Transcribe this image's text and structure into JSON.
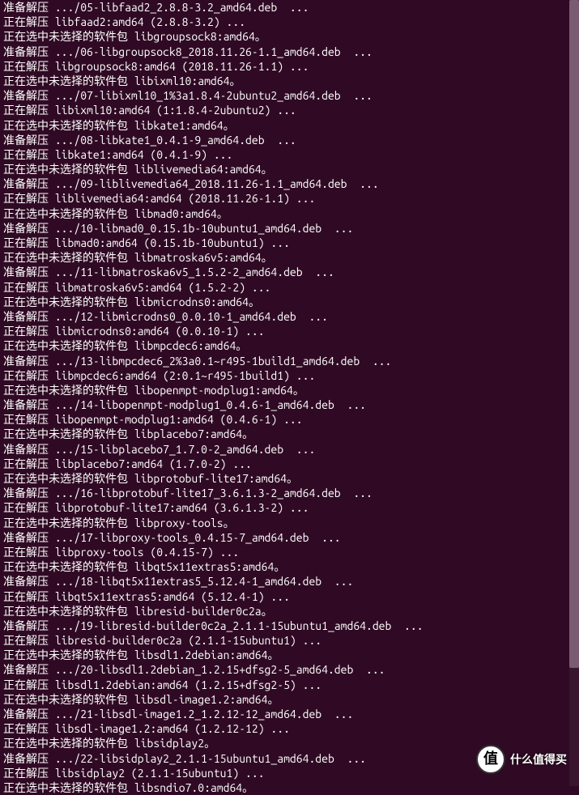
{
  "terminal": {
    "lines": [
      "准备解压 .../05-libfaad2_2.8.8-3.2_amd64.deb  ...",
      "正在解压 libfaad2:amd64 (2.8.8-3.2) ...",
      "正在选中未选择的软件包 libgroupsock8:amd64。",
      "准备解压 .../06-libgroupsock8_2018.11.26-1.1_amd64.deb  ...",
      "正在解压 libgroupsock8:amd64 (2018.11.26-1.1) ...",
      "正在选中未选择的软件包 libixml10:amd64。",
      "准备解压 .../07-libixml10_1%3a1.8.4-2ubuntu2_amd64.deb  ...",
      "正在解压 libixml10:amd64 (1:1.8.4-2ubuntu2) ...",
      "正在选中未选择的软件包 libkate1:amd64。",
      "准备解压 .../08-libkate1_0.4.1-9_amd64.deb  ...",
      "正在解压 libkate1:amd64 (0.4.1-9) ...",
      "正在选中未选择的软件包 liblivemedia64:amd64。",
      "准备解压 .../09-liblivemedia64_2018.11.26-1.1_amd64.deb  ...",
      "正在解压 liblivemedia64:amd64 (2018.11.26-1.1) ...",
      "正在选中未选择的软件包 libmad0:amd64。",
      "准备解压 .../10-libmad0_0.15.1b-10ubuntu1_amd64.deb  ...",
      "正在解压 libmad0:amd64 (0.15.1b-10ubuntu1) ...",
      "正在选中未选择的软件包 libmatroska6v5:amd64。",
      "准备解压 .../11-libmatroska6v5_1.5.2-2_amd64.deb  ...",
      "正在解压 libmatroska6v5:amd64 (1.5.2-2) ...",
      "正在选中未选择的软件包 libmicrodns0:amd64。",
      "准备解压 .../12-libmicrodns0_0.0.10-1_amd64.deb  ...",
      "正在解压 libmicrodns0:amd64 (0.0.10-1) ...",
      "正在选中未选择的软件包 libmpcdec6:amd64。",
      "准备解压 .../13-libmpcdec6_2%3a0.1~r495-1build1_amd64.deb  ...",
      "正在解压 libmpcdec6:amd64 (2:0.1~r495-1build1) ...",
      "正在选中未选择的软件包 libopenmpt-modplug1:amd64。",
      "准备解压 .../14-libopenmpt-modplug1_0.4.6-1_amd64.deb  ...",
      "正在解压 libopenmpt-modplug1:amd64 (0.4.6-1) ...",
      "正在选中未选择的软件包 libplacebo7:amd64。",
      "准备解压 .../15-libplacebo7_1.7.0-2_amd64.deb  ...",
      "正在解压 libplacebo7:amd64 (1.7.0-2) ...",
      "正在选中未选择的软件包 libprotobuf-lite17:amd64。",
      "准备解压 .../16-libprotobuf-lite17_3.6.1.3-2_amd64.deb  ...",
      "正在解压 libprotobuf-lite17:amd64 (3.6.1.3-2) ...",
      "正在选中未选择的软件包 libproxy-tools。",
      "准备解压 .../17-libproxy-tools_0.4.15-7_amd64.deb  ...",
      "正在解压 libproxy-tools (0.4.15-7) ...",
      "正在选中未选择的软件包 libqt5x11extras5:amd64。",
      "准备解压 .../18-libqt5x11extras5_5.12.4-1_amd64.deb  ...",
      "正在解压 libqt5x11extras5:amd64 (5.12.4-1) ...",
      "正在选中未选择的软件包 libresid-builder0c2a。",
      "准备解压 .../19-libresid-builder0c2a_2.1.1-15ubuntu1_amd64.deb  ...",
      "正在解压 libresid-builder0c2a (2.1.1-15ubuntu1) ...",
      "正在选中未选择的软件包 libsdl1.2debian:amd64。",
      "准备解压 .../20-libsdl1.2debian_1.2.15+dfsg2-5_amd64.deb  ...",
      "正在解压 libsdl1.2debian:amd64 (1.2.15+dfsg2-5) ...",
      "正在选中未选择的软件包 libsdl-image1.2:amd64。",
      "准备解压 .../21-libsdl-image1.2_1.2.12-12_amd64.deb  ...",
      "正在解压 libsdl-image1.2:amd64 (1.2.12-12) ...",
      "正在选中未选择的软件包 libsidplay2。",
      "准备解压 .../22-libsidplay2_2.1.1-15ubuntu1_amd64.deb  ...",
      "正在解压 libsidplay2 (2.1.1-15ubuntu1) ...",
      "正在选中未选择的软件包 libsndio7.0:amd64。"
    ]
  },
  "watermark": {
    "badge": "值",
    "text": "什么值得买"
  }
}
